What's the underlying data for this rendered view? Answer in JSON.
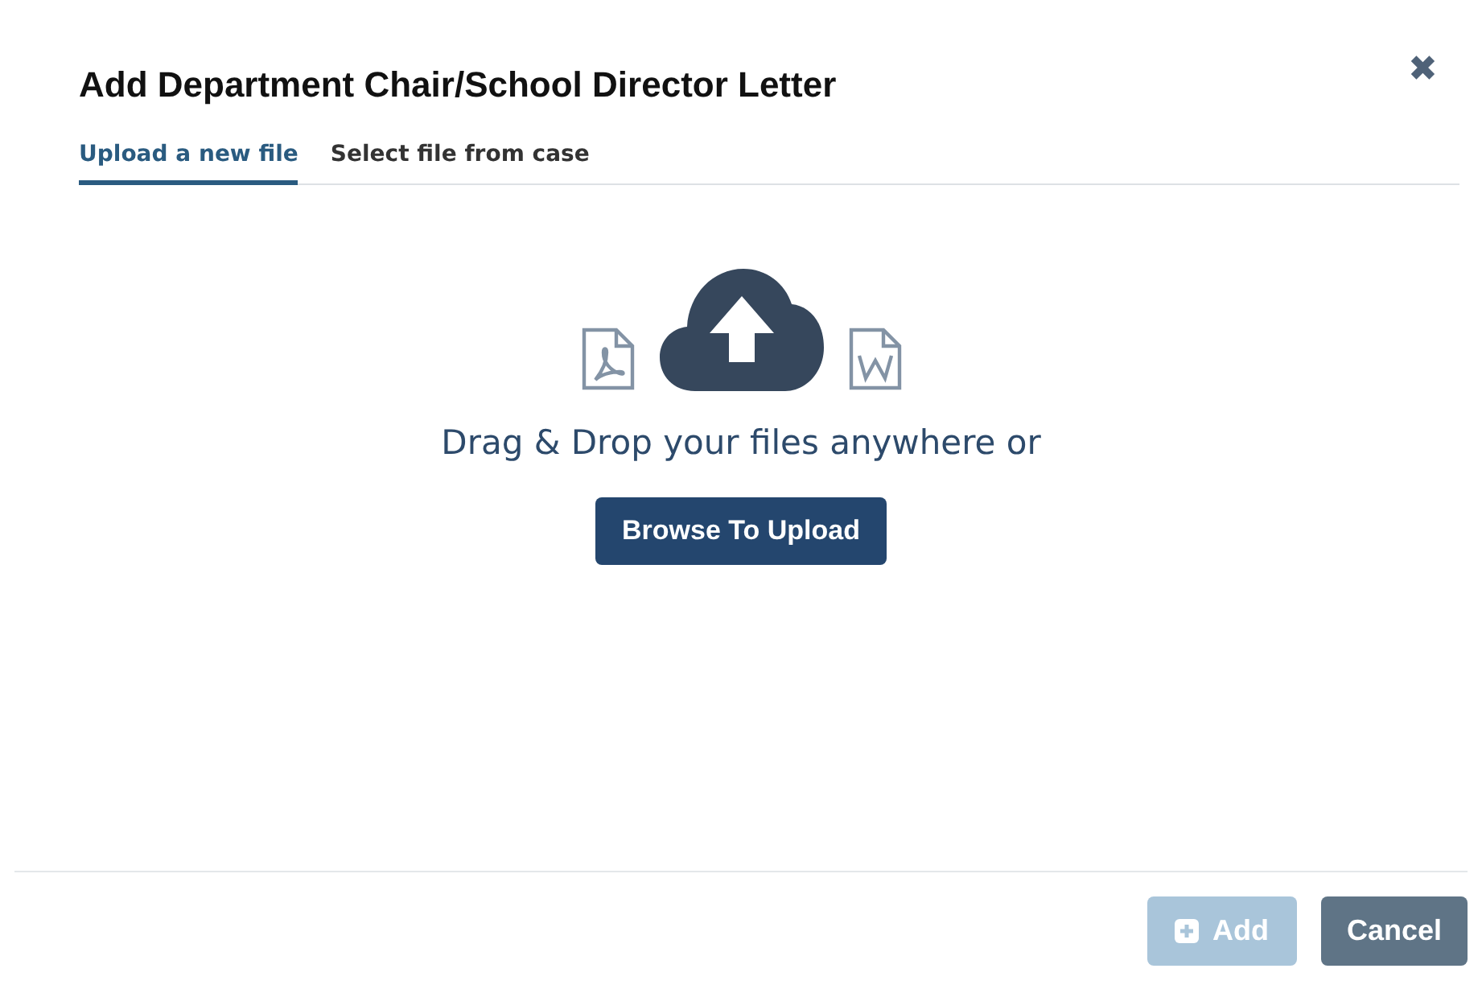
{
  "dialog": {
    "title": "Add Department Chair/School Director Letter",
    "close": "✖"
  },
  "tabs": [
    {
      "label": "Upload a new file",
      "selected": true
    },
    {
      "label": "Select file from case",
      "selected": false
    }
  ],
  "dropzone": {
    "prompt": "Drag & Drop your files anywhere or",
    "button": "Browse To Upload"
  },
  "footer": {
    "buttons": [
      {
        "label": "Add",
        "kind": "add",
        "disabled": true
      },
      {
        "label": "Cancel",
        "kind": "cancel",
        "disabled": false
      }
    ]
  }
}
